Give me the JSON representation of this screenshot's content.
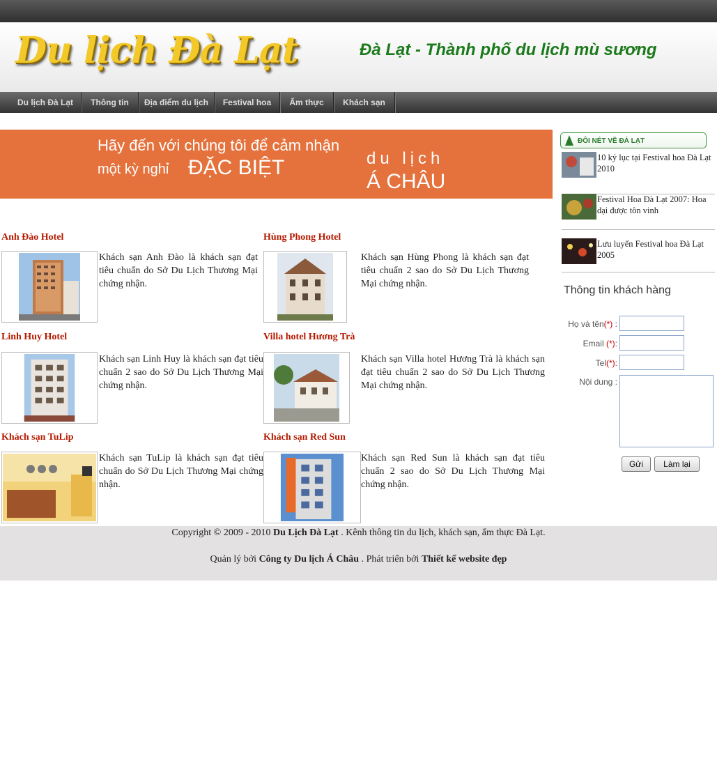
{
  "header": {
    "logo_text": "Du lịch Đà Lạt",
    "slogan": "Đà Lạt - Thành phố du lịch mù sương"
  },
  "nav": {
    "items": [
      "Du lịch Đà Lạt",
      "Thông tin",
      "Địa điểm du lịch",
      "Festival hoa",
      "Ẩm thực",
      "Khách sạn"
    ]
  },
  "banner": {
    "line1": "Hãy đến với chúng tôi để cảm nhận",
    "line2a": "một kỳ nghỉ",
    "line2b": "ĐẶC BIỆT",
    "line3": "du lịch",
    "line4": "Á CHÂU",
    "color": "#e5723c"
  },
  "hotels": [
    {
      "title": "Anh Đào Hotel",
      "desc": "Khách sạn Anh Đào là khách sạn đạt tiêu chuẩn do Sở Du Lịch Thương Mại chứng nhận."
    },
    {
      "title": "Hùng Phong Hotel",
      "desc": "Khách sạn Hùng Phong là khách sạn đạt tiêu chuẩn 2 sao do Sở Du Lịch Thương Mại chứng nhận."
    },
    {
      "title": "Linh Huy Hotel",
      "desc": "Khách sạn Linh Huy là khách sạn đạt tiêu chuẩn 2 sao do Sở Du Lịch Thương Mại chứng nhận."
    },
    {
      "title": "Villa hotel Hương Trà",
      "desc": "Khách sạn Villa hotel Hương Trà là khách sạn đạt tiêu chuẩn 2 sao do Sở Du Lịch Thương Mại chứng nhận."
    },
    {
      "title": "Khách sạn TuLip",
      "desc": "Khách sạn TuLip là khách sạn đạt tiêu chuẩn do Sở Du Lịch Thương Mại chứng nhận."
    },
    {
      "title": "Khách sạn Red Sun",
      "desc": "Khách sạn Red Sun là khách sạn đạt tiêu chuẩn 2 sao do Sở Du Lịch Thương Mại chứng nhận."
    }
  ],
  "sidebar": {
    "heading": "ĐÔI NÉT VỀ ĐÀ LẠT",
    "news": [
      {
        "text": "10 kỷ lục tại Festival hoa Đà Lạt 2010"
      },
      {
        "text": "Festival Hoa Đà Lạt 2007: Hoa dại được tôn vinh"
      },
      {
        "text": "Lưu luyến Festival hoa Đà Lạt 2005"
      }
    ]
  },
  "contact_form": {
    "title": "Thông tin khách hàng",
    "name_label": "Họ và tên",
    "email_label": "Email",
    "tel_label": "Tel",
    "content_label": "Nội dung :",
    "required_mark": "(*)",
    "colon": ":",
    "submit_label": "Gửi",
    "reset_label": "Làm lại"
  },
  "footer": {
    "l1_prefix": "Copyright © 2009 - 2010",
    "l1_brand": "Du Lịch Đà Lạt",
    "l1_suffix": ". Kênh thông tin du lịch, khách sạn, ẩm thực Đà Lạt.",
    "l2_prefix": "Quản lý bởi",
    "l2_company": "Công ty Du lịch Á Châu",
    "l2_mid": ". Phát triển bởi",
    "l2_dev": "Thiết kế website đẹp"
  }
}
